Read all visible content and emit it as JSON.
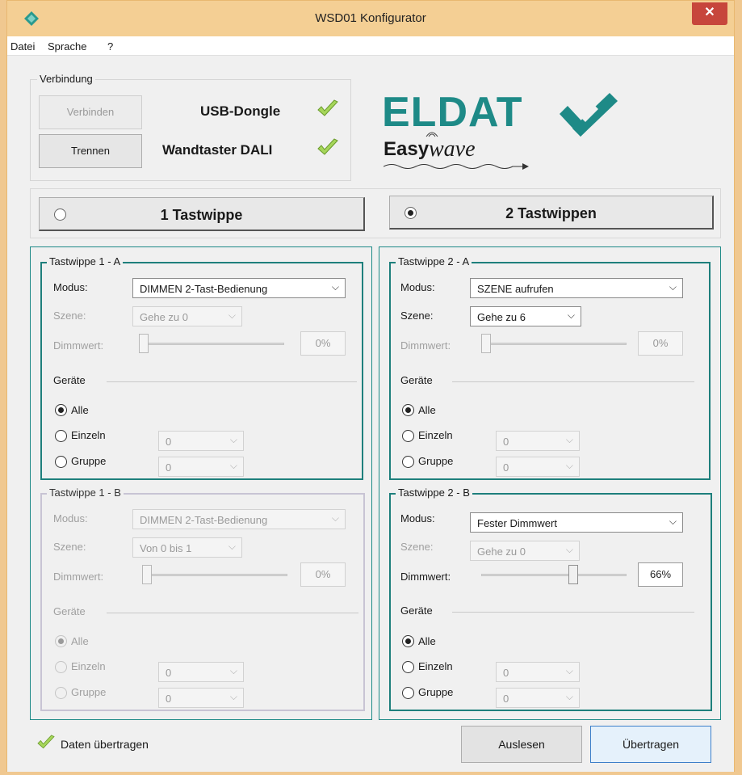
{
  "window": {
    "title": "WSD01 Konfigurator",
    "close_symbol": "✕",
    "app_icon": "app-diamond-icon"
  },
  "menu": {
    "items": [
      "Datei",
      "Sprache",
      "?"
    ]
  },
  "connection": {
    "legend": "Verbindung",
    "connect_label": "Verbinden",
    "disconnect_label": "Trennen",
    "usb_label": "USB-Dongle",
    "wall_label": "Wandtaster DALI"
  },
  "logo": {
    "brand": "ELDAT",
    "sub_bold": "Easy",
    "sub_italic": "wave"
  },
  "mode": {
    "one_label": "1 Tastwippe",
    "two_label": "2 Tastwippen",
    "selected": "2 Tastwippen"
  },
  "labels": {
    "modus": "Modus:",
    "szene": "Szene:",
    "dimmwert": "Dimmwert:",
    "geraete": "Geräte",
    "alle": "Alle",
    "einzeln": "Einzeln",
    "gruppe": "Gruppe"
  },
  "groups": [
    {
      "legend": "Tastwippe 1 - A",
      "modus": "DIMMEN 2-Tast-Bedienung",
      "szene": "Gehe zu 0",
      "dimmwert": "0%",
      "einzeln": "0",
      "gruppe": "0"
    },
    {
      "legend": "Tastwippe 2 - A",
      "modus": "SZENE aufrufen",
      "szene": "Gehe zu 6",
      "dimmwert": "0%",
      "einzeln": "0",
      "gruppe": "0"
    },
    {
      "legend": "Tastwippe 1 - B",
      "modus": "DIMMEN 2-Tast-Bedienung",
      "szene": "Von 0 bis 1",
      "dimmwert": "0%",
      "einzeln": "0",
      "gruppe": "0"
    },
    {
      "legend": "Tastwippe 2 - B",
      "modus": "Fester Dimmwert",
      "szene": "Gehe zu 0",
      "dimmwert": "66%",
      "einzeln": "0",
      "gruppe": "0"
    }
  ],
  "footer": {
    "status": "Daten übertragen",
    "read_label": "Auslesen",
    "transfer_label": "Übertragen"
  },
  "colors": {
    "teal": "#1e8a87",
    "check_green": "#9ad14b",
    "title_bar": "#f4cf94",
    "close_red": "#c7463c"
  }
}
